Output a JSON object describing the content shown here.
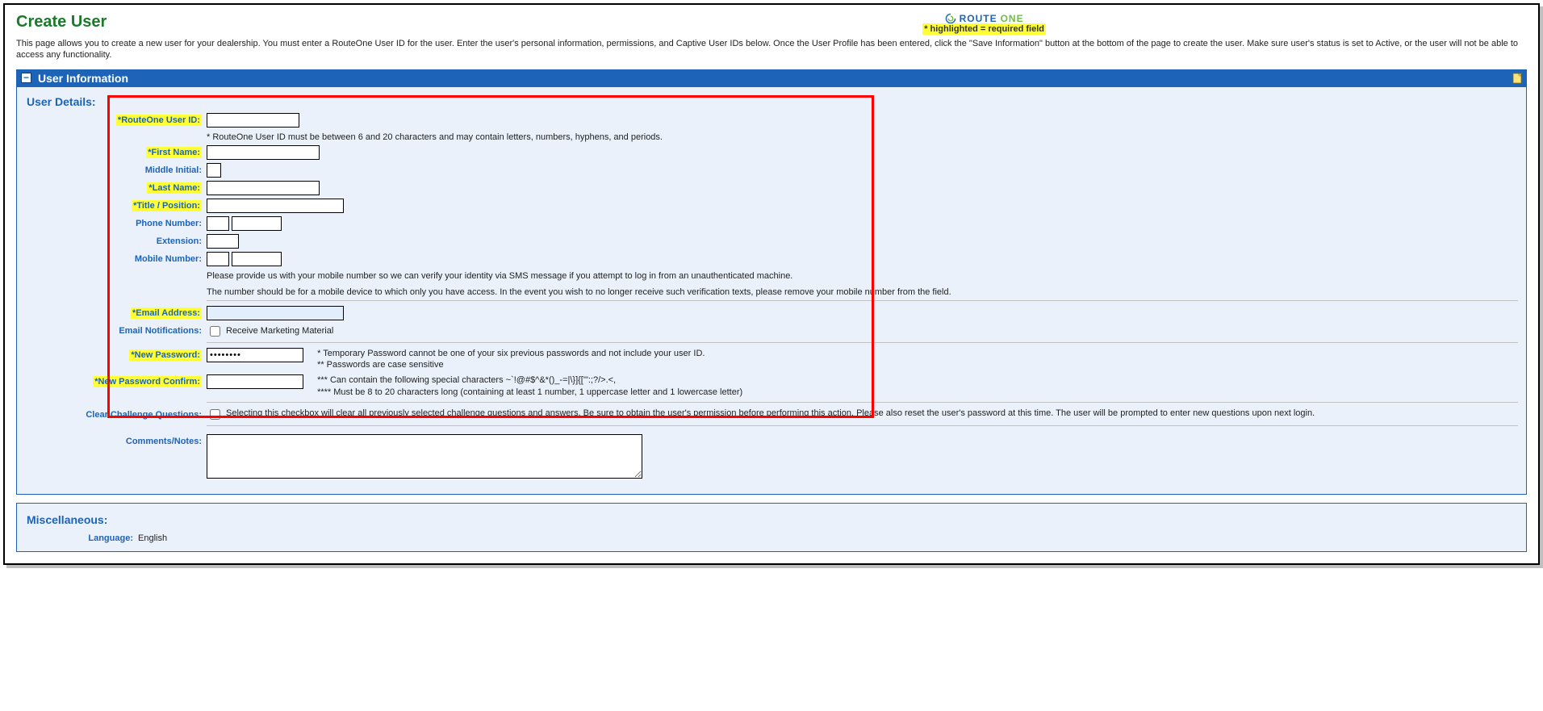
{
  "header": {
    "title": "Create User",
    "logo_route": "ROUTE",
    "logo_one": "ONE",
    "required_note": "* highlighted = required field",
    "intro": "This page allows you to create a new user for your dealership. You must enter a RouteOne User ID for the user. Enter the user's personal information, permissions, and Captive User IDs below. Once the User Profile has been entered, click the \"Save Information\" button at the bottom of the page to create the user. Make sure user's status is set to Active, or the user will not be able to access any functionality."
  },
  "section": {
    "title": "User Information"
  },
  "user_details": {
    "heading": "User Details:",
    "labels": {
      "user_id": "*RouteOne User ID:",
      "first_name": "*First Name:",
      "middle_initial": "Middle Initial:",
      "last_name": "*Last Name:",
      "title_position": "*Title / Position:",
      "phone": "Phone Number:",
      "extension": "Extension:",
      "mobile": "Mobile Number:",
      "email": "*Email Address:",
      "email_notifications": "Email Notifications:",
      "new_password": "*New Password:",
      "new_password_confirm": "*New Password Confirm:",
      "clear_challenge": "Clear Challenge Questions:",
      "comments": "Comments/Notes:"
    },
    "hints": {
      "user_id": "* RouteOne User ID must be between 6 and 20 characters and may contain letters, numbers, hyphens, and periods.",
      "mobile_line1": "Please provide us with your mobile number so we can verify your identity via SMS message if you attempt to log in from an unauthenticated machine.",
      "mobile_line2": "The number should be for a mobile device to which only you have access. In the event you wish to no longer receive such verification texts, please remove your mobile number from the field.",
      "pwd_l1": "* Temporary Password cannot be one of your six previous passwords and not include your user ID.",
      "pwd_l2": "** Passwords are case sensitive",
      "pwd_l3": "*** Can contain the following special characters ~`!@#$^&*()_-=|\\}]{['\":;?/>.<,",
      "pwd_l4": "**** Must be 8 to 20 characters long (containing at least 1 number, 1 uppercase letter and 1 lowercase letter)"
    },
    "marketing_label": "Receive Marketing Material",
    "clear_challenge_text": "Selecting this checkbox will clear all previously selected challenge questions and answers. Be sure to obtain the user's permission before performing this action. Please also reset the user's password at this time. The user will be prompted to enter new questions upon next login.",
    "values": {
      "user_id": "",
      "first_name": "",
      "middle_initial": "",
      "last_name": "",
      "title_position": "",
      "phone_area": "",
      "phone_num": "",
      "extension": "",
      "mobile_area": "",
      "mobile_num": "",
      "email": "",
      "new_password": "••••••••",
      "new_password_confirm": "",
      "comments": ""
    }
  },
  "misc": {
    "heading": "Miscellaneous:",
    "language_label": "Language:",
    "language_value": "English"
  }
}
